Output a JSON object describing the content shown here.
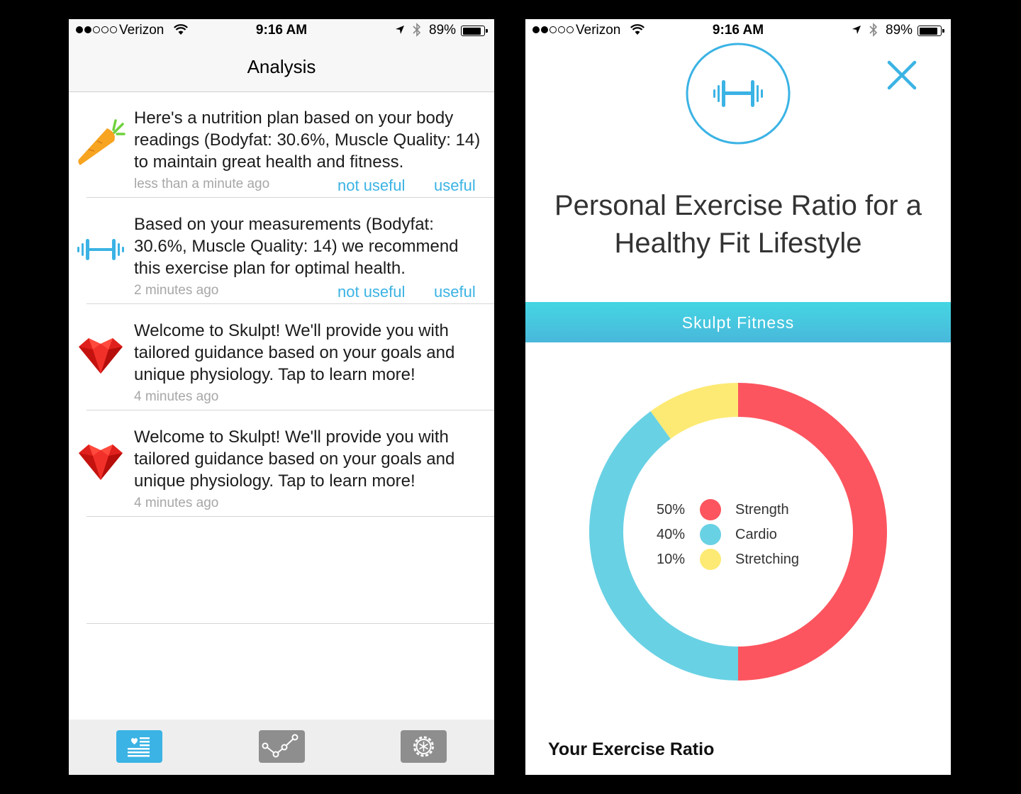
{
  "status_bar": {
    "carrier": "Verizon",
    "time": "9:16 AM",
    "battery": "89%",
    "battery_level": 0.89,
    "signal_bars_filled": 2,
    "signal_bars_total": 5
  },
  "analysis": {
    "title": "Analysis",
    "items": [
      {
        "icon": "carrot-icon",
        "message": "Here's a nutrition plan based on your body readings (Bodyfat: 30.6%, Muscle Quality: 14) to maintain great health and fitness.",
        "time": "less than a minute ago",
        "not_useful": "not useful",
        "useful": "useful"
      },
      {
        "icon": "dumbbell-icon",
        "message": "Based on your measurements (Bodyfat: 30.6%, Muscle Quality: 14) we recommend this exercise plan for optimal health.",
        "time": "2 minutes ago",
        "not_useful": "not useful",
        "useful": "useful"
      },
      {
        "icon": "heart-gem-icon",
        "message": "Welcome to Skulpt! We'll provide you with tailored guidance based on your goals and unique physiology. Tap to learn more!",
        "time": "4 minutes ago"
      },
      {
        "icon": "heart-gem-icon",
        "message": "Welcome to Skulpt! We'll provide you with tailored guidance based on your goals and unique physiology. Tap to learn more!",
        "time": "4 minutes ago"
      }
    ],
    "tabs": [
      {
        "icon": "analysis-list-icon",
        "active": true
      },
      {
        "icon": "trends-chart-icon",
        "active": false
      },
      {
        "icon": "settings-gear-icon",
        "active": false
      }
    ]
  },
  "exercise": {
    "headline": "Personal Exercise Ratio for a Healthy Fit Lifestyle",
    "banner": "Skulpt Fitness",
    "section_title": "Your Exercise Ratio",
    "colors": {
      "accent": "#3bb3e4",
      "strength": "#fc555f",
      "cardio": "#69d1e4",
      "stretching": "#fdea74"
    }
  },
  "chart_data": {
    "type": "pie",
    "variant": "donut",
    "categories": [
      "Strength",
      "Cardio",
      "Stretching"
    ],
    "values": [
      50,
      40,
      10
    ],
    "labels": [
      "50%",
      "40%",
      "10%"
    ],
    "colors": [
      "#fc555f",
      "#69d1e4",
      "#fdea74"
    ],
    "legend_position": "center"
  }
}
